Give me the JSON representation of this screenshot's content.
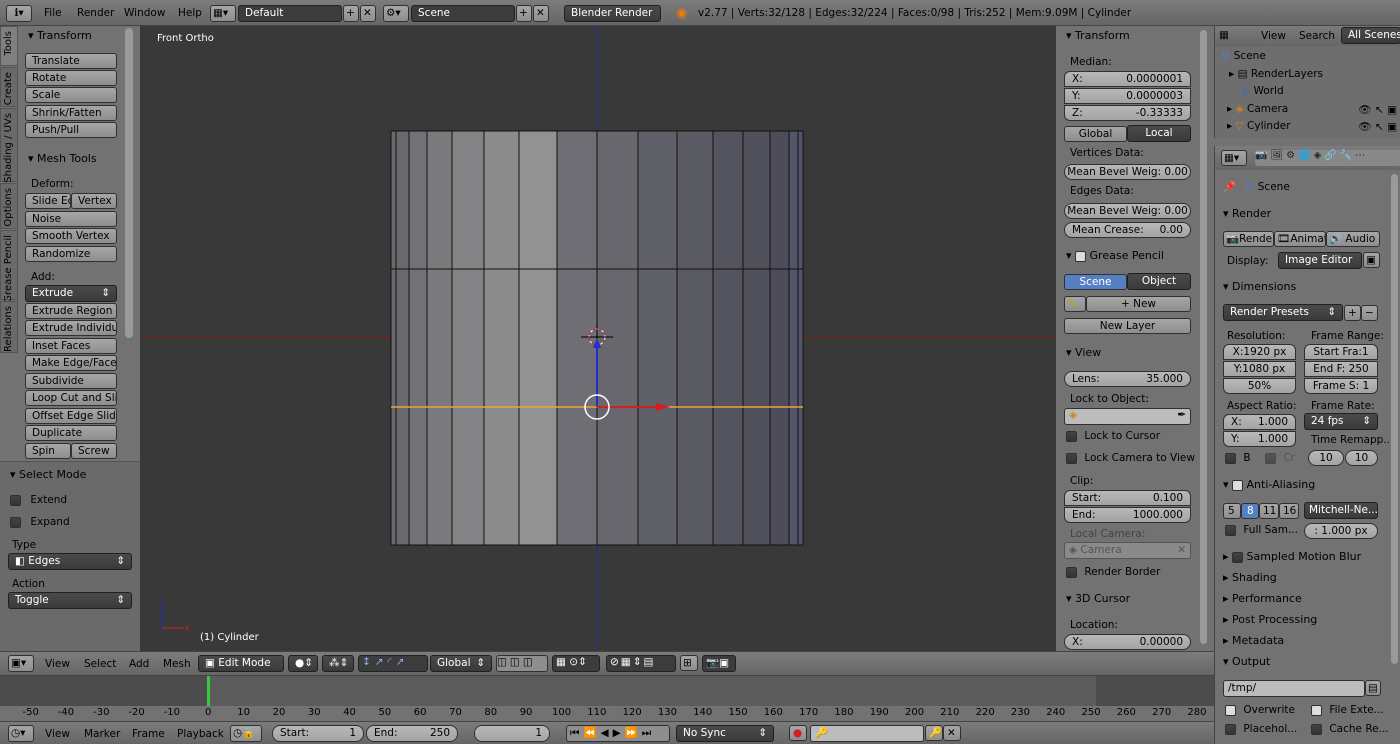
{
  "topbar": {
    "menus": [
      "File",
      "Render",
      "Window",
      "Help"
    ],
    "layout": "Default",
    "scene": "Scene",
    "engine": "Blender Render",
    "stats": "v2.77 | Verts:32/128 | Edges:32/224 | Faces:0/98 | Tris:252 | Mem:9.09M | Cylinder"
  },
  "tool_shelf": {
    "tabs": [
      "Tools",
      "Create",
      "Shading / UVs",
      "Options",
      "Grease Pencil",
      "Relations"
    ],
    "transform_title": "Transform",
    "transform_buttons": [
      "Translate",
      "Rotate",
      "Scale",
      "Shrink/Fatten",
      "Push/Pull"
    ],
    "mesh_tools_title": "Mesh Tools",
    "deform_label": "Deform:",
    "slide_edge": "Slide Ed",
    "vertex": "Vertex",
    "noise": "Noise",
    "smooth_vertex": "Smooth Vertex",
    "randomize": "Randomize",
    "add_label": "Add:",
    "extrude": "Extrude",
    "add_buttons": [
      "Extrude Region",
      "Extrude Individual",
      "Inset Faces",
      "Make Edge/Face",
      "Subdivide",
      "Loop Cut and Slide",
      "Offset Edge Slide",
      "Duplicate"
    ],
    "spin": "Spin",
    "screw": "Screw"
  },
  "select_mode": {
    "title": "Select Mode",
    "extend": "Extend",
    "expand": "Expand",
    "type_label": "Type",
    "type_value": "Edges",
    "action_label": "Action",
    "action_value": "Toggle"
  },
  "viewport": {
    "view_name": "Front Ortho",
    "object_label": "(1) Cylinder"
  },
  "properties_n": {
    "transform_title": "Transform",
    "median_label": "Median:",
    "x_label": "X:",
    "x_value": "0.0000001",
    "y_label": "Y:",
    "y_value": "0.0000003",
    "z_label": "Z:",
    "z_value": "-0.33333",
    "global": "Global",
    "local": "Local",
    "vertices_data": "Vertices Data:",
    "mean_bevel_v": "Mean Bevel Weig: 0.00",
    "edges_data": "Edges Data:",
    "mean_bevel_e": "Mean Bevel Weig: 0.00",
    "mean_crease_label": "Mean Crease:",
    "mean_crease_value": "0.00",
    "grease_pencil_title": "Grease Pencil",
    "gp_scene": "Scene",
    "gp_object": "Object",
    "gp_new": "New",
    "gp_new_layer": "New Layer",
    "view_title": "View",
    "lens_label": "Lens:",
    "lens_value": "35.000",
    "lock_to_object": "Lock to Object:",
    "lock_to_cursor": "Lock to Cursor",
    "lock_camera": "Lock Camera to View",
    "clip_label": "Clip:",
    "start_label": "Start:",
    "start_value": "0.100",
    "end_label": "End:",
    "end_value": "1000.000",
    "local_camera": "Local Camera:",
    "camera": "Camera",
    "render_border": "Render Border",
    "cursor_title": "3D Cursor",
    "location_label": "Location:",
    "cx_label": "X:",
    "cx_value": "0.00000"
  },
  "outliner": {
    "view": "View",
    "search": "Search",
    "all_scenes": "All Scenes",
    "items": [
      "Scene",
      "RenderLayers",
      "World",
      "Camera",
      "Cylinder"
    ]
  },
  "render_props": {
    "scene": "Scene",
    "render_title": "Render",
    "render_btn": "Render",
    "anim_btn": "Animati",
    "audio_btn": "Audio",
    "display_label": "Display:",
    "display_value": "Image Editor",
    "dimensions_title": "Dimensions",
    "presets": "Render Presets",
    "resolution_label": "Resolution:",
    "frame_range_label": "Frame Range:",
    "res_x": "X:1920 px",
    "res_y": "Y:1080 px",
    "res_pct": "50%",
    "start_frame": "Start Fra:1",
    "end_frame": "End F: 250",
    "frame_step": "Frame S: 1",
    "aspect_label": "Aspect Ratio:",
    "frame_rate_label": "Frame Rate:",
    "ax_label": "X:",
    "ax_value": "1.000",
    "ay_label": "Y:",
    "ay_value": "1.000",
    "fps": "24 fps",
    "time_remap": "Time Remapp...",
    "b": "B",
    "cr": "Cr",
    "remap_old": "10",
    "remap_new": "10",
    "aa_title": "Anti-Aliasing",
    "aa_samples": [
      "5",
      "8",
      "11",
      "16"
    ],
    "filter": "Mitchell-Ne...",
    "full_sample": "Full Sam...",
    "filter_size": ": 1.000 px",
    "motion_blur": "Sampled Motion Blur",
    "shading": "Shading",
    "performance": "Performance",
    "post_processing": "Post Processing",
    "metadata": "Metadata",
    "output": "Output",
    "output_path": "/tmp/",
    "overwrite": "Overwrite",
    "file_ext": "File Exte...",
    "placeholders": "Placehol...",
    "cache_result": "Cache Re..."
  },
  "view3d_header": {
    "menus": [
      "View",
      "Select",
      "Add",
      "Mesh"
    ],
    "mode": "Edit Mode",
    "orientation": "Global"
  },
  "timeline": {
    "ticks": [
      "-50",
      "-40",
      "-30",
      "-20",
      "-10",
      "0",
      "10",
      "20",
      "30",
      "40",
      "50",
      "60",
      "70",
      "80",
      "90",
      "100",
      "110",
      "120",
      "130",
      "140",
      "150",
      "160",
      "170",
      "180",
      "190",
      "200",
      "210",
      "220",
      "230",
      "240",
      "250",
      "260",
      "270",
      "280"
    ],
    "menus": [
      "View",
      "Marker",
      "Frame",
      "Playback"
    ],
    "start_label": "Start:",
    "start_value": "1",
    "end_label": "End:",
    "end_value": "250",
    "current": "1",
    "sync": "No Sync"
  },
  "colors": {
    "accent": "#5680c2",
    "viewport_bg": "#393939",
    "axis_red": "#a02020",
    "axis_blue": "#2030b0",
    "select_orange": "#f0a040",
    "playhead": "#3cc83c"
  }
}
